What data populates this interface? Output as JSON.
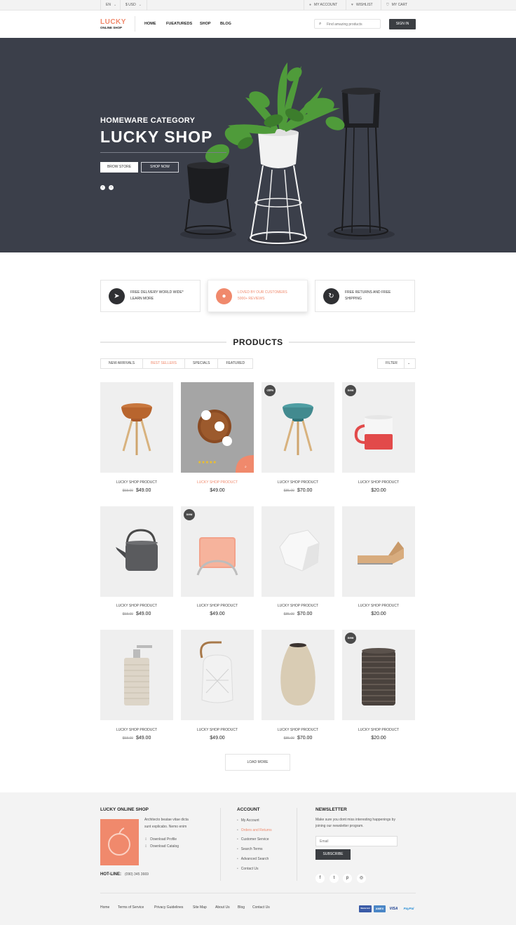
{
  "topbar": {
    "language": "EN",
    "currency": "$ USD",
    "my_account": "MY ACCOUNT",
    "wishlist": "WISHLIST",
    "my_cart": "MY CART"
  },
  "header": {
    "logo_main": "LUCKY",
    "logo_sub": "ONLINE SHOP",
    "nav": [
      "HOME",
      "FUEATUREDS",
      "SHOP",
      "BLOG"
    ],
    "search_placeholder": "Find amazing products",
    "signin": "SIGN IN"
  },
  "hero": {
    "subtitle": "HOMEWARE CATEGORY",
    "title": "LUCKY SHOP",
    "btn_primary": "BROW STORE",
    "btn_secondary": "SHOP NOW"
  },
  "features": [
    {
      "line1": "FREE DELIVERY WORLD WIDE*",
      "line2": "LEARN MORE",
      "icon": "paper-plane-icon"
    },
    {
      "line1": "LOVED BY OUR CUSTOMERS",
      "line2": "5000+ REVIEWS",
      "icon": "user-icon"
    },
    {
      "line1": "FREE RETURNS AND FREE",
      "line2": "SHIPPING",
      "icon": "refresh-icon"
    }
  ],
  "products_section": {
    "title": "PRODUCTS",
    "tabs": [
      "NEW ARRIVALS",
      "BEST SELLERS",
      "SPECIALS",
      "FEATURED"
    ],
    "active_tab": 1,
    "filter": "FILTER",
    "load_more": "LOAD MORE"
  },
  "products": [
    {
      "name": "LUCKY SHOP PRODUCT",
      "old_price": "$58.00",
      "price": "$49.00",
      "badge": "",
      "image": "orange-stool"
    },
    {
      "name": "LUCKY SHOP PRODUCT",
      "old_price": "",
      "price": "$49.00",
      "badge": "",
      "image": "wooden-board",
      "hovered": true
    },
    {
      "name": "LUCKY SHOP PRODUCT",
      "old_price": "$85.00",
      "price": "$70.00",
      "badge": "-20%",
      "image": "teal-stool"
    },
    {
      "name": "LUCKY SHOP PRODUCT",
      "old_price": "",
      "price": "$20.00",
      "badge": "new",
      "image": "red-mug"
    },
    {
      "name": "LUCKY SHOP PRODUCT",
      "old_price": "$58.00",
      "price": "$49.00",
      "badge": "",
      "image": "kettle"
    },
    {
      "name": "LUCKY SHOP PRODUCT",
      "old_price": "",
      "price": "$49.00",
      "badge": "new",
      "image": "pink-stand"
    },
    {
      "name": "LUCKY SHOP PRODUCT",
      "old_price": "$85.00",
      "price": "$70.00",
      "badge": "",
      "image": "white-speaker"
    },
    {
      "name": "LUCKY SHOP PRODUCT",
      "old_price": "",
      "price": "$20.00",
      "badge": "",
      "image": "wood-lounger"
    },
    {
      "name": "LUCKY SHOP PRODUCT",
      "old_price": "$58.00",
      "price": "$49.00",
      "badge": "",
      "image": "soap-dispenser"
    },
    {
      "name": "LUCKY SHOP PRODUCT",
      "old_price": "",
      "price": "$49.00",
      "badge": "",
      "image": "lantern"
    },
    {
      "name": "LUCKY SHOP PRODUCT",
      "old_price": "$85.00",
      "price": "$70.00",
      "badge": "",
      "image": "vase"
    },
    {
      "name": "LUCKY SHOP PRODUCT",
      "old_price": "",
      "price": "$20.00",
      "badge": "new",
      "image": "striped-cup"
    }
  ],
  "footer": {
    "about_title": "LUCKY ONLINE SHOP",
    "about_text_1": "Architecto beatae vitae dicta",
    "about_text_2": "sunt explicabo. Nemo enim",
    "download_profile": "Download Profile",
    "download_catalog": "Download Catalog",
    "hotline_label": "HOT-LINE:",
    "hotline_number": "(090) 345 3669",
    "account_title": "ACCOUNT",
    "account_links": [
      "My Account",
      "Orders and Returns",
      "Customer Service",
      "Search Terms",
      "Advanced Search",
      "Contact Us"
    ],
    "newsletter_title": "NEWSLETTER",
    "newsletter_text_1": "Make sure you dont miss interesting happenings by",
    "newsletter_text_2": "joining our newsletter program.",
    "email_placeholder": "Email",
    "subscribe": "SUBSCRIBE",
    "social": [
      {
        "icon": "facebook-icon",
        "glyph": "f"
      },
      {
        "icon": "twitter-icon",
        "glyph": "t"
      },
      {
        "icon": "pinterest-icon",
        "glyph": "p"
      },
      {
        "icon": "instagram-icon",
        "glyph": "◎"
      }
    ],
    "bottom_links": [
      "Home",
      "Terms of Service",
      "Privacy Guidelines",
      "Site Map",
      "About Us",
      "Blog",
      "Contact Us"
    ],
    "payments": [
      {
        "name": "MasterCard",
        "color": "#3a5ba7",
        "label": "Mastercard"
      },
      {
        "name": "AmEx",
        "color": "#4a86c6",
        "label": "AMEX"
      },
      {
        "name": "Visa",
        "color": "#1a3d8f",
        "label": "VISA"
      },
      {
        "name": "PayPal",
        "color": "#2a8fd6",
        "label": "PayPal"
      }
    ]
  },
  "colors": {
    "accent": "#f0896c",
    "dark": "#3b3e42",
    "hero_bg": "#3b3f4a"
  }
}
